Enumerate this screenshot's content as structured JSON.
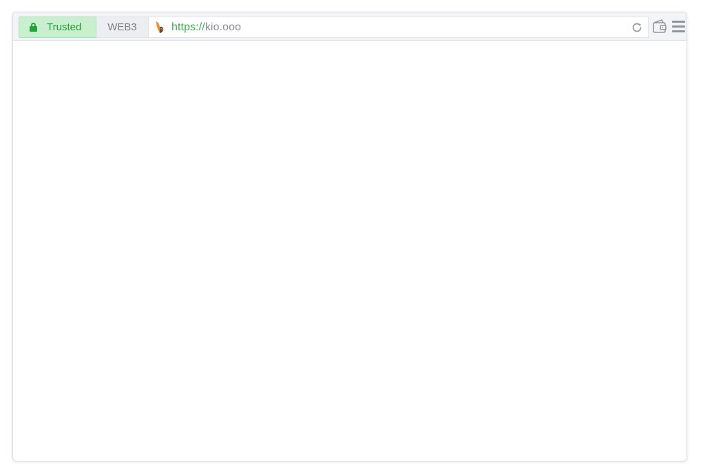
{
  "toolbar": {
    "trusted": {
      "label": "Trusted",
      "icon": "lock-icon",
      "color": "#1ea53a"
    },
    "web3_tab": {
      "label": "WEB3"
    },
    "address": {
      "scheme": "https://",
      "host": "kio.ooo",
      "favicon": "orange-leaf-icon"
    },
    "icons": {
      "reload": "reload-icon",
      "wallet": "wallet-icon",
      "menu": "hamburger-menu-icon"
    }
  },
  "colors": {
    "trusted_bg": "#c9efcf",
    "url_scheme": "#3dae4f",
    "toolbar_bg": "#f2f4f7"
  }
}
